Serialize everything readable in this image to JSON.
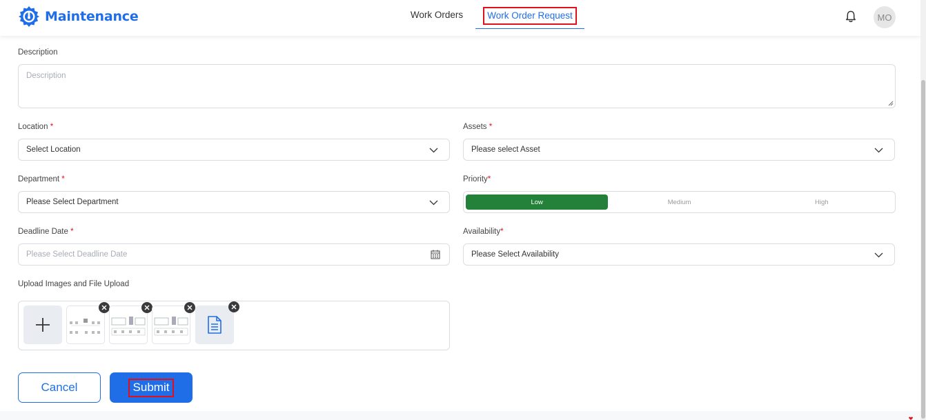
{
  "app": {
    "title": "Maintenance"
  },
  "nav": {
    "tabs": [
      {
        "label": "Work Orders",
        "active": false
      },
      {
        "label": "Work Order Request",
        "active": true
      }
    ],
    "user_initials": "MO"
  },
  "form": {
    "description": {
      "label": "Description",
      "placeholder": "Description"
    },
    "location": {
      "label": "Location",
      "required": "*",
      "value": "Select Location"
    },
    "assets": {
      "label": "Assets",
      "required": "*",
      "value": "Please select Asset"
    },
    "department": {
      "label": "Department",
      "required": "*",
      "value": "Please Select Department"
    },
    "priority": {
      "label": "Priority",
      "required": "*",
      "options": [
        "Low",
        "Medium",
        "High"
      ],
      "selected": "Low"
    },
    "deadline": {
      "label": "Deadline Date",
      "required": "*",
      "placeholder": "Please Select Deadline Date"
    },
    "availability": {
      "label": "Availability",
      "required": "*",
      "value": "Please Select Availability"
    },
    "upload": {
      "label": "Upload Images and File Upload"
    }
  },
  "actions": {
    "cancel_label": "Cancel",
    "submit_label": "Submit"
  },
  "colors": {
    "accent": "#1f6ee8",
    "priority_active": "#23813a",
    "required": "#e0101a",
    "highlight": "#e0101a"
  },
  "icons": [
    "logo-icon",
    "bell-icon",
    "chevron-down-icon",
    "calendar-icon",
    "plus-icon",
    "close-icon",
    "document-icon",
    "heart-icon"
  ]
}
